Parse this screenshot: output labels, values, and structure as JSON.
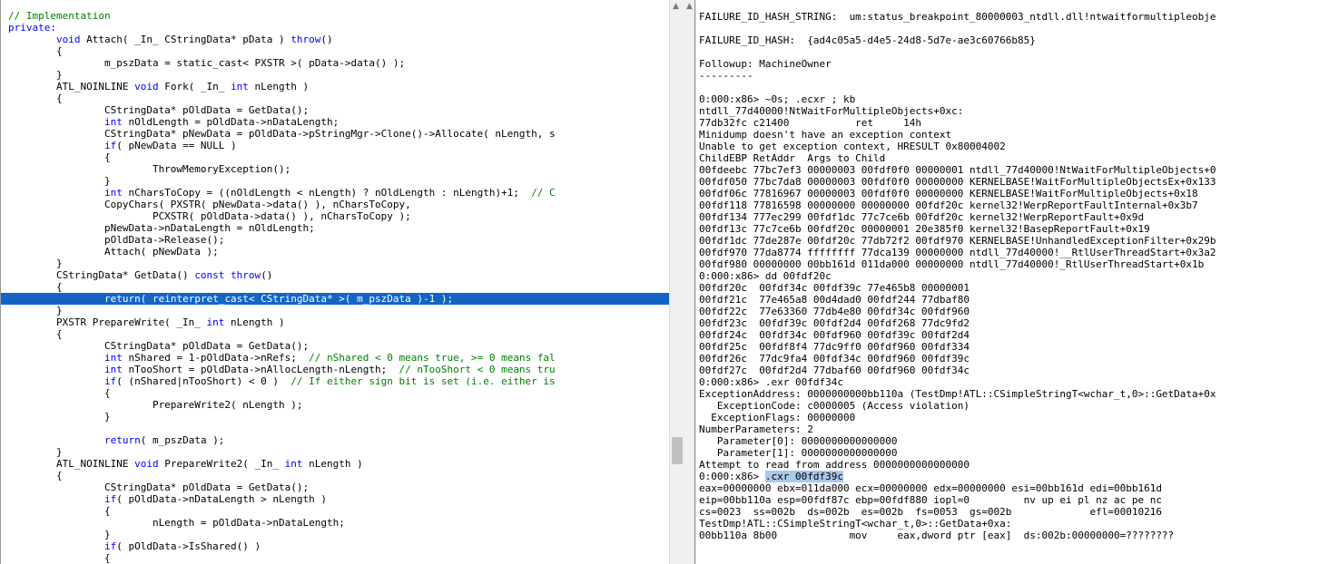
{
  "source": {
    "lines": [
      [
        [
          "cm",
          "// Implementation"
        ]
      ],
      [
        [
          "kw",
          "private:"
        ]
      ],
      [
        [
          "",
          "        "
        ],
        [
          "kw",
          "void"
        ],
        [
          "",
          " Attach( _In_ CStringData* pData ) "
        ],
        [
          "kw",
          "throw"
        ],
        [
          "",
          "()"
        ]
      ],
      [
        [
          "",
          "        {"
        ]
      ],
      [
        [
          "",
          "                m_pszData = static_cast< PXSTR >( pData->data() );"
        ]
      ],
      [
        [
          "",
          "        }"
        ]
      ],
      [
        [
          "",
          "        ATL_NOINLINE "
        ],
        [
          "kw",
          "void"
        ],
        [
          "",
          " Fork( _In_ "
        ],
        [
          "kw",
          "int"
        ],
        [
          "",
          " nLength )"
        ]
      ],
      [
        [
          "",
          "        {"
        ]
      ],
      [
        [
          "",
          "                CStringData* pOldData = GetData();"
        ]
      ],
      [
        [
          "",
          "                "
        ],
        [
          "kw",
          "int"
        ],
        [
          "",
          " nOldLength = pOldData->nDataLength;"
        ]
      ],
      [
        [
          "",
          "                CStringData* pNewData = pOldData->pStringMgr->Clone()->Allocate( nLength, s"
        ]
      ],
      [
        [
          "",
          "                "
        ],
        [
          "kw",
          "if"
        ],
        [
          "",
          "( pNewData == NULL )"
        ]
      ],
      [
        [
          "",
          "                {"
        ]
      ],
      [
        [
          "",
          "                        ThrowMemoryException();"
        ]
      ],
      [
        [
          "",
          "                }"
        ]
      ],
      [
        [
          "",
          "                "
        ],
        [
          "kw",
          "int"
        ],
        [
          "",
          " nCharsToCopy = ((nOldLength < nLength) ? nOldLength : nLength)+1;  "
        ],
        [
          "cm",
          "// C"
        ]
      ],
      [
        [
          "",
          "                CopyChars( PXSTR( pNewData->data() ), nCharsToCopy,"
        ]
      ],
      [
        [
          "",
          "                        PCXSTR( pOldData->data() ), nCharsToCopy );"
        ]
      ],
      [
        [
          "",
          "                pNewData->nDataLength = nOldLength;"
        ]
      ],
      [
        [
          "",
          "                pOldData->Release();"
        ]
      ],
      [
        [
          "",
          "                Attach( pNewData );"
        ]
      ],
      [
        [
          "",
          "        }"
        ]
      ],
      [
        [
          "",
          "        CStringData* GetData() "
        ],
        [
          "kw",
          "const"
        ],
        [
          "",
          " "
        ],
        [
          "kw",
          "throw"
        ],
        [
          "",
          "()"
        ]
      ],
      [
        [
          "",
          "        {"
        ]
      ],
      [
        [
          "",
          "                "
        ],
        [
          "kw",
          "return"
        ],
        [
          "",
          "( "
        ],
        [
          "kw",
          "reinterpret_cast"
        ],
        [
          "",
          "< CStringData* >( m_pszData )-1 );"
        ]
      ],
      [
        [
          "",
          "        }"
        ]
      ],
      [
        [
          "",
          "        PXSTR PrepareWrite( _In_ "
        ],
        [
          "kw",
          "int"
        ],
        [
          "",
          " nLength )"
        ]
      ],
      [
        [
          "",
          "        {"
        ]
      ],
      [
        [
          "",
          "                CStringData* pOldData = GetData();"
        ]
      ],
      [
        [
          "",
          "                "
        ],
        [
          "kw",
          "int"
        ],
        [
          "",
          " nShared = 1-pOldData->nRefs;  "
        ],
        [
          "cm",
          "// nShared < 0 means true, >= 0 means fal"
        ]
      ],
      [
        [
          "",
          "                "
        ],
        [
          "kw",
          "int"
        ],
        [
          "",
          " nTooShort = pOldData->nAllocLength-nLength;  "
        ],
        [
          "cm",
          "// nTooShort < 0 means tru"
        ]
      ],
      [
        [
          "",
          "                "
        ],
        [
          "kw",
          "if"
        ],
        [
          "",
          "( (nShared|nTooShort) < 0 )  "
        ],
        [
          "cm",
          "// If either sign bit is set (i.e. either is"
        ]
      ],
      [
        [
          "",
          "                {"
        ]
      ],
      [
        [
          "",
          "                        PrepareWrite2( nLength );"
        ]
      ],
      [
        [
          "",
          "                }"
        ]
      ],
      [
        [
          "",
          ""
        ]
      ],
      [
        [
          "",
          "                "
        ],
        [
          "kw",
          "return"
        ],
        [
          "",
          "( m_pszData );"
        ]
      ],
      [
        [
          "",
          "        }"
        ]
      ],
      [
        [
          "",
          "        ATL_NOINLINE "
        ],
        [
          "kw",
          "void"
        ],
        [
          "",
          " PrepareWrite2( _In_ "
        ],
        [
          "kw",
          "int"
        ],
        [
          "",
          " nLength )"
        ]
      ],
      [
        [
          "",
          "        {"
        ]
      ],
      [
        [
          "",
          "                CStringData* pOldData = GetData();"
        ]
      ],
      [
        [
          "",
          "                "
        ],
        [
          "kw",
          "if"
        ],
        [
          "",
          "( pOldData->nDataLength > nLength )"
        ]
      ],
      [
        [
          "",
          "                {"
        ]
      ],
      [
        [
          "",
          "                        nLength = pOldData->nDataLength;"
        ]
      ],
      [
        [
          "",
          "                }"
        ]
      ],
      [
        [
          "",
          "                "
        ],
        [
          "kw",
          "if"
        ],
        [
          "",
          "( pOldData->IsShared() )"
        ]
      ],
      [
        [
          "",
          "                {"
        ]
      ]
    ],
    "highlight_line": 24
  },
  "debugger": {
    "lines": [
      "FAILURE_ID_HASH_STRING:  um:status_breakpoint_80000003_ntdll.dll!ntwaitformultipleobje",
      "",
      "FAILURE_ID_HASH:  {ad4c05a5-d4e5-24d8-5d7e-ae3c60766b85}",
      "",
      "Followup: MachineOwner",
      "---------",
      "",
      "0:000:x86> ~0s; .ecxr ; kb",
      "ntdll_77d40000!NtWaitForMultipleObjects+0xc:",
      "77db32fc c21400           ret     14h",
      "Minidump doesn't have an exception context",
      "Unable to get exception context, HRESULT 0x80004002",
      "ChildEBP RetAddr  Args to Child",
      "00fdeebc 77bc7ef3 00000003 00fdf0f0 00000001 ntdll_77d40000!NtWaitForMultipleObjects+0",
      "00fdf050 77bc7da8 00000003 00fdf0f0 00000000 KERNELBASE!WaitForMultipleObjectsEx+0x133",
      "00fdf06c 77816967 00000003 00fdf0f0 00000000 KERNELBASE!WaitForMultipleObjects+0x18",
      "00fdf118 77816598 00000000 00000000 00fdf20c kernel32!WerpReportFaultInternal+0x3b7",
      "00fdf134 777ec299 00fdf1dc 77c7ce6b 00fdf20c kernel32!WerpReportFault+0x9d",
      "00fdf13c 77c7ce6b 00fdf20c 00000001 20e385f0 kernel32!BasepReportFault+0x19",
      "00fdf1dc 77de287e 00fdf20c 77db72f2 00fdf970 KERNELBASE!UnhandledExceptionFilter+0x29b",
      "00fdf970 77da8774 ffffffff 77dca139 00000000 ntdll_77d40000!__RtlUserThreadStart+0x3a2",
      "00fdf980 00000000 00bb161d 011da000 00000000 ntdll_77d40000!_RtlUserThreadStart+0x1b",
      "0:000:x86> dd 00fdf20c",
      "00fdf20c  00fdf34c 00fdf39c 77e465b8 00000001",
      "00fdf21c  77e465a8 00d4dad0 00fdf244 77dbaf80",
      "00fdf22c  77e63360 77db4e80 00fdf34c 00fdf960",
      "00fdf23c  00fdf39c 00fdf2d4 00fdf268 77dc9fd2",
      "00fdf24c  00fdf34c 00fdf960 00fdf39c 00fdf2d4",
      "00fdf25c  00fdf8f4 77dc9ff0 00fdf960 00fdf334",
      "00fdf26c  77dc9fa4 00fdf34c 00fdf960 00fdf39c",
      "00fdf27c  00fdf2d4 77dbaf60 00fdf960 00fdf34c",
      "0:000:x86> .exr 00fdf34c",
      "ExceptionAddress: 0000000000bb110a (TestDmp!ATL::CSimpleStringT<wchar_t,0>::GetData+0x",
      "   ExceptionCode: c0000005 (Access violation)",
      "  ExceptionFlags: 00000000",
      "NumberParameters: 2",
      "   Parameter[0]: 0000000000000000",
      "   Parameter[1]: 0000000000000000",
      "Attempt to read from address 0000000000000000",
      "0:000:x86> ",
      "eax=00000000 ebx=011da000 ecx=00000000 edx=00000000 esi=00bb161d edi=00bb161d",
      "eip=00bb110a esp=00fdf87c ebp=00fdf880 iopl=0         nv up ei pl nz ac pe nc",
      "cs=0023  ss=002b  ds=002b  es=002b  fs=0053  gs=002b             efl=00010216",
      "TestDmp!ATL::CSimpleStringT<wchar_t,0>::GetData+0xa:",
      "00bb110a 8b00            mov     eax,dword ptr [eax]  ds:002b:00000000=????????"
    ],
    "selected_command": ".cxr 00fdf39c",
    "selected_line": 39
  }
}
